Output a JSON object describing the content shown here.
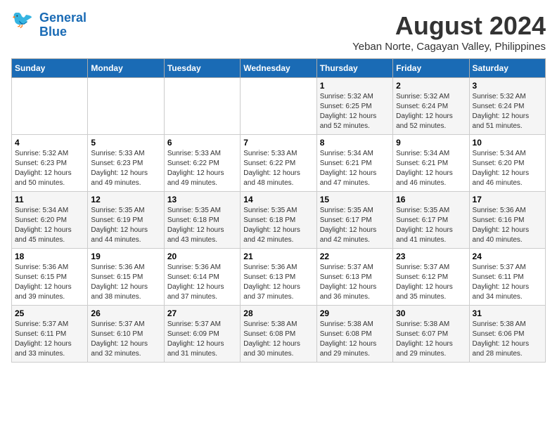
{
  "header": {
    "logo_line1": "General",
    "logo_line2": "Blue",
    "month_year": "August 2024",
    "location": "Yeban Norte, Cagayan Valley, Philippines"
  },
  "days_of_week": [
    "Sunday",
    "Monday",
    "Tuesday",
    "Wednesday",
    "Thursday",
    "Friday",
    "Saturday"
  ],
  "weeks": [
    [
      {
        "day": "",
        "info": ""
      },
      {
        "day": "",
        "info": ""
      },
      {
        "day": "",
        "info": ""
      },
      {
        "day": "",
        "info": ""
      },
      {
        "day": "1",
        "info": "Sunrise: 5:32 AM\nSunset: 6:25 PM\nDaylight: 12 hours\nand 52 minutes."
      },
      {
        "day": "2",
        "info": "Sunrise: 5:32 AM\nSunset: 6:24 PM\nDaylight: 12 hours\nand 52 minutes."
      },
      {
        "day": "3",
        "info": "Sunrise: 5:32 AM\nSunset: 6:24 PM\nDaylight: 12 hours\nand 51 minutes."
      }
    ],
    [
      {
        "day": "4",
        "info": "Sunrise: 5:32 AM\nSunset: 6:23 PM\nDaylight: 12 hours\nand 50 minutes."
      },
      {
        "day": "5",
        "info": "Sunrise: 5:33 AM\nSunset: 6:23 PM\nDaylight: 12 hours\nand 49 minutes."
      },
      {
        "day": "6",
        "info": "Sunrise: 5:33 AM\nSunset: 6:22 PM\nDaylight: 12 hours\nand 49 minutes."
      },
      {
        "day": "7",
        "info": "Sunrise: 5:33 AM\nSunset: 6:22 PM\nDaylight: 12 hours\nand 48 minutes."
      },
      {
        "day": "8",
        "info": "Sunrise: 5:34 AM\nSunset: 6:21 PM\nDaylight: 12 hours\nand 47 minutes."
      },
      {
        "day": "9",
        "info": "Sunrise: 5:34 AM\nSunset: 6:21 PM\nDaylight: 12 hours\nand 46 minutes."
      },
      {
        "day": "10",
        "info": "Sunrise: 5:34 AM\nSunset: 6:20 PM\nDaylight: 12 hours\nand 46 minutes."
      }
    ],
    [
      {
        "day": "11",
        "info": "Sunrise: 5:34 AM\nSunset: 6:20 PM\nDaylight: 12 hours\nand 45 minutes."
      },
      {
        "day": "12",
        "info": "Sunrise: 5:35 AM\nSunset: 6:19 PM\nDaylight: 12 hours\nand 44 minutes."
      },
      {
        "day": "13",
        "info": "Sunrise: 5:35 AM\nSunset: 6:18 PM\nDaylight: 12 hours\nand 43 minutes."
      },
      {
        "day": "14",
        "info": "Sunrise: 5:35 AM\nSunset: 6:18 PM\nDaylight: 12 hours\nand 42 minutes."
      },
      {
        "day": "15",
        "info": "Sunrise: 5:35 AM\nSunset: 6:17 PM\nDaylight: 12 hours\nand 42 minutes."
      },
      {
        "day": "16",
        "info": "Sunrise: 5:35 AM\nSunset: 6:17 PM\nDaylight: 12 hours\nand 41 minutes."
      },
      {
        "day": "17",
        "info": "Sunrise: 5:36 AM\nSunset: 6:16 PM\nDaylight: 12 hours\nand 40 minutes."
      }
    ],
    [
      {
        "day": "18",
        "info": "Sunrise: 5:36 AM\nSunset: 6:15 PM\nDaylight: 12 hours\nand 39 minutes."
      },
      {
        "day": "19",
        "info": "Sunrise: 5:36 AM\nSunset: 6:15 PM\nDaylight: 12 hours\nand 38 minutes."
      },
      {
        "day": "20",
        "info": "Sunrise: 5:36 AM\nSunset: 6:14 PM\nDaylight: 12 hours\nand 37 minutes."
      },
      {
        "day": "21",
        "info": "Sunrise: 5:36 AM\nSunset: 6:13 PM\nDaylight: 12 hours\nand 37 minutes."
      },
      {
        "day": "22",
        "info": "Sunrise: 5:37 AM\nSunset: 6:13 PM\nDaylight: 12 hours\nand 36 minutes."
      },
      {
        "day": "23",
        "info": "Sunrise: 5:37 AM\nSunset: 6:12 PM\nDaylight: 12 hours\nand 35 minutes."
      },
      {
        "day": "24",
        "info": "Sunrise: 5:37 AM\nSunset: 6:11 PM\nDaylight: 12 hours\nand 34 minutes."
      }
    ],
    [
      {
        "day": "25",
        "info": "Sunrise: 5:37 AM\nSunset: 6:11 PM\nDaylight: 12 hours\nand 33 minutes."
      },
      {
        "day": "26",
        "info": "Sunrise: 5:37 AM\nSunset: 6:10 PM\nDaylight: 12 hours\nand 32 minutes."
      },
      {
        "day": "27",
        "info": "Sunrise: 5:37 AM\nSunset: 6:09 PM\nDaylight: 12 hours\nand 31 minutes."
      },
      {
        "day": "28",
        "info": "Sunrise: 5:38 AM\nSunset: 6:08 PM\nDaylight: 12 hours\nand 30 minutes."
      },
      {
        "day": "29",
        "info": "Sunrise: 5:38 AM\nSunset: 6:08 PM\nDaylight: 12 hours\nand 29 minutes."
      },
      {
        "day": "30",
        "info": "Sunrise: 5:38 AM\nSunset: 6:07 PM\nDaylight: 12 hours\nand 29 minutes."
      },
      {
        "day": "31",
        "info": "Sunrise: 5:38 AM\nSunset: 6:06 PM\nDaylight: 12 hours\nand 28 minutes."
      }
    ]
  ]
}
